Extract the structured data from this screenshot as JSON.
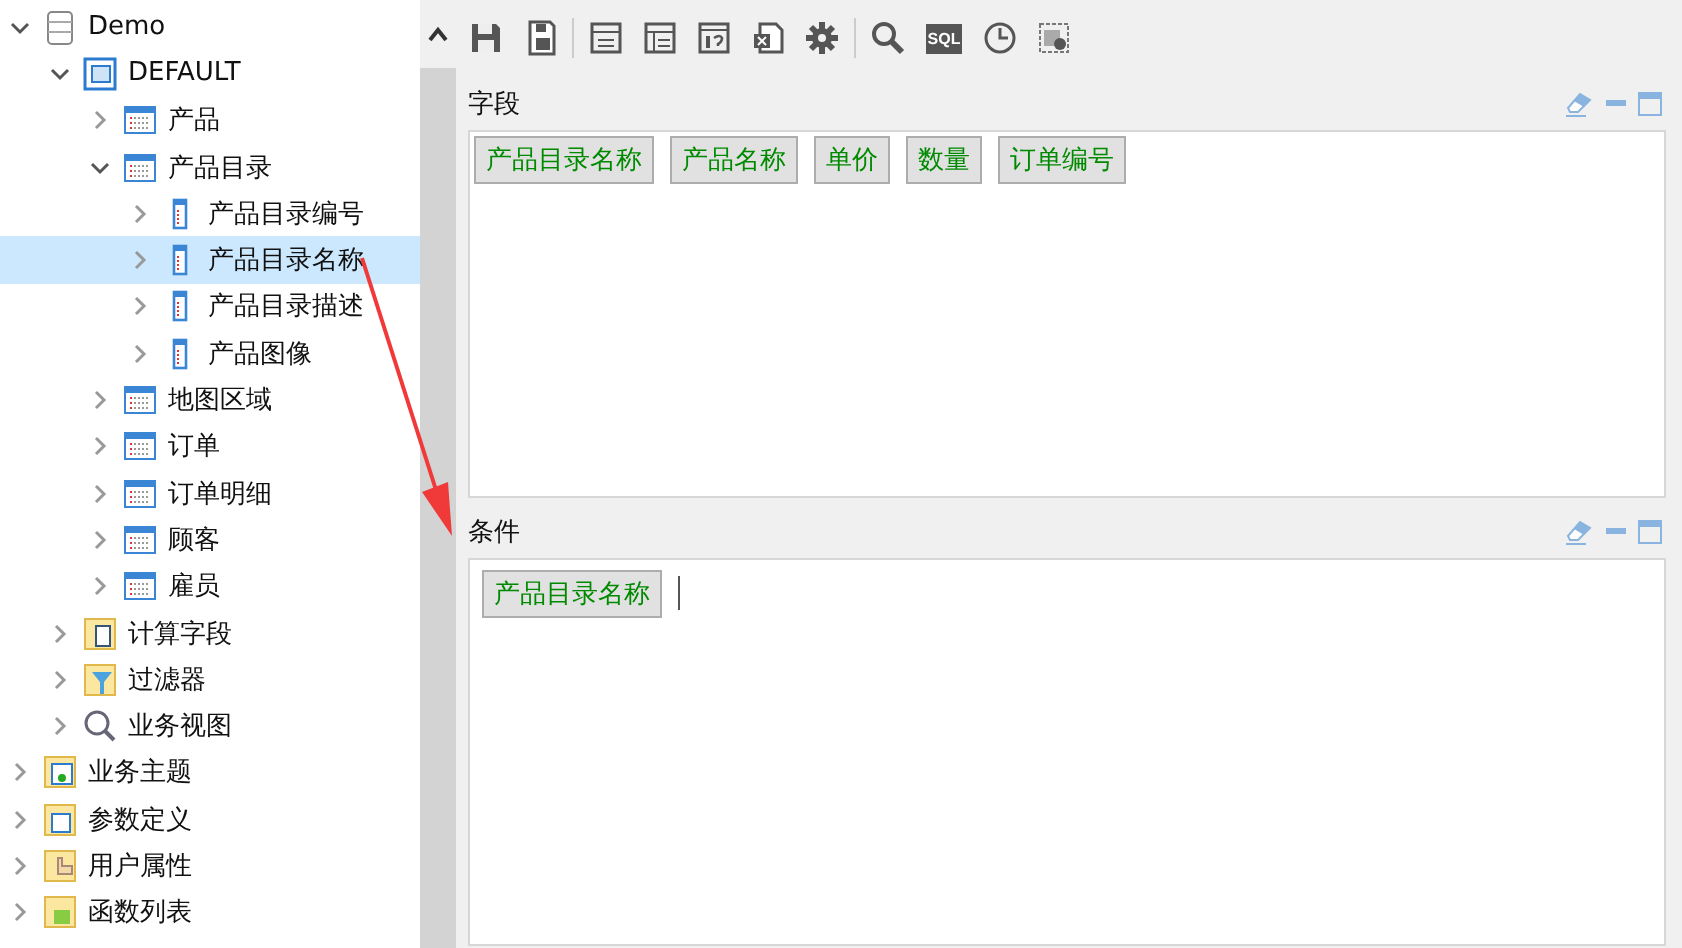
{
  "tree": [
    {
      "label": "Demo",
      "kind": "database",
      "expanded": true,
      "selected": false,
      "children": [
        {
          "label": "DEFAULT",
          "kind": "schema",
          "expanded": true,
          "selected": false,
          "children": [
            {
              "label": "产品",
              "kind": "table",
              "expanded": false,
              "selected": false
            },
            {
              "label": "产品目录",
              "kind": "table",
              "expanded": true,
              "selected": false,
              "children": [
                {
                  "label": "产品目录编号",
                  "kind": "field",
                  "expanded": false,
                  "selected": false
                },
                {
                  "label": "产品目录名称",
                  "kind": "field",
                  "expanded": false,
                  "selected": true
                },
                {
                  "label": "产品目录描述",
                  "kind": "field",
                  "expanded": false,
                  "selected": false
                },
                {
                  "label": "产品图像",
                  "kind": "field",
                  "expanded": false,
                  "selected": false
                }
              ]
            },
            {
              "label": "地图区域",
              "kind": "table",
              "expanded": false,
              "selected": false
            },
            {
              "label": "订单",
              "kind": "table",
              "expanded": false,
              "selected": false
            },
            {
              "label": "订单明细",
              "kind": "table",
              "expanded": false,
              "selected": false
            },
            {
              "label": "顾客",
              "kind": "table",
              "expanded": false,
              "selected": false
            },
            {
              "label": "雇员",
              "kind": "table",
              "expanded": false,
              "selected": false
            }
          ]
        },
        {
          "label": "计算字段",
          "kind": "calc-folder",
          "expanded": false,
          "selected": false
        },
        {
          "label": "过滤器",
          "kind": "filter-folder",
          "expanded": false,
          "selected": false
        },
        {
          "label": "业务视图",
          "kind": "search",
          "expanded": false,
          "selected": false
        }
      ]
    },
    {
      "label": "业务主题",
      "kind": "subject-folder",
      "expanded": false,
      "selected": false
    },
    {
      "label": "参数定义",
      "kind": "param-folder",
      "expanded": false,
      "selected": false
    },
    {
      "label": "用户属性",
      "kind": "hand-folder",
      "expanded": false,
      "selected": false
    },
    {
      "label": "函数列表",
      "kind": "func-folder",
      "expanded": false,
      "selected": false
    }
  ],
  "toolbar": [
    {
      "kind": "save"
    },
    {
      "kind": "save-as"
    },
    {
      "kind": "separator"
    },
    {
      "kind": "layout"
    },
    {
      "kind": "grid"
    },
    {
      "kind": "help-doc"
    },
    {
      "kind": "excel"
    },
    {
      "kind": "gear"
    },
    {
      "kind": "separator"
    },
    {
      "kind": "search"
    },
    {
      "kind": "sql",
      "label": "SQL"
    },
    {
      "kind": "clock"
    },
    {
      "kind": "add-doc"
    }
  ],
  "panels": [
    {
      "title": "字段",
      "chips": [
        "产品目录名称",
        "产品名称",
        "单价",
        "数量",
        "订单编号"
      ],
      "cursor": false
    },
    {
      "title": "条件",
      "chips": [
        "产品目录名称"
      ],
      "cursor": true
    }
  ]
}
